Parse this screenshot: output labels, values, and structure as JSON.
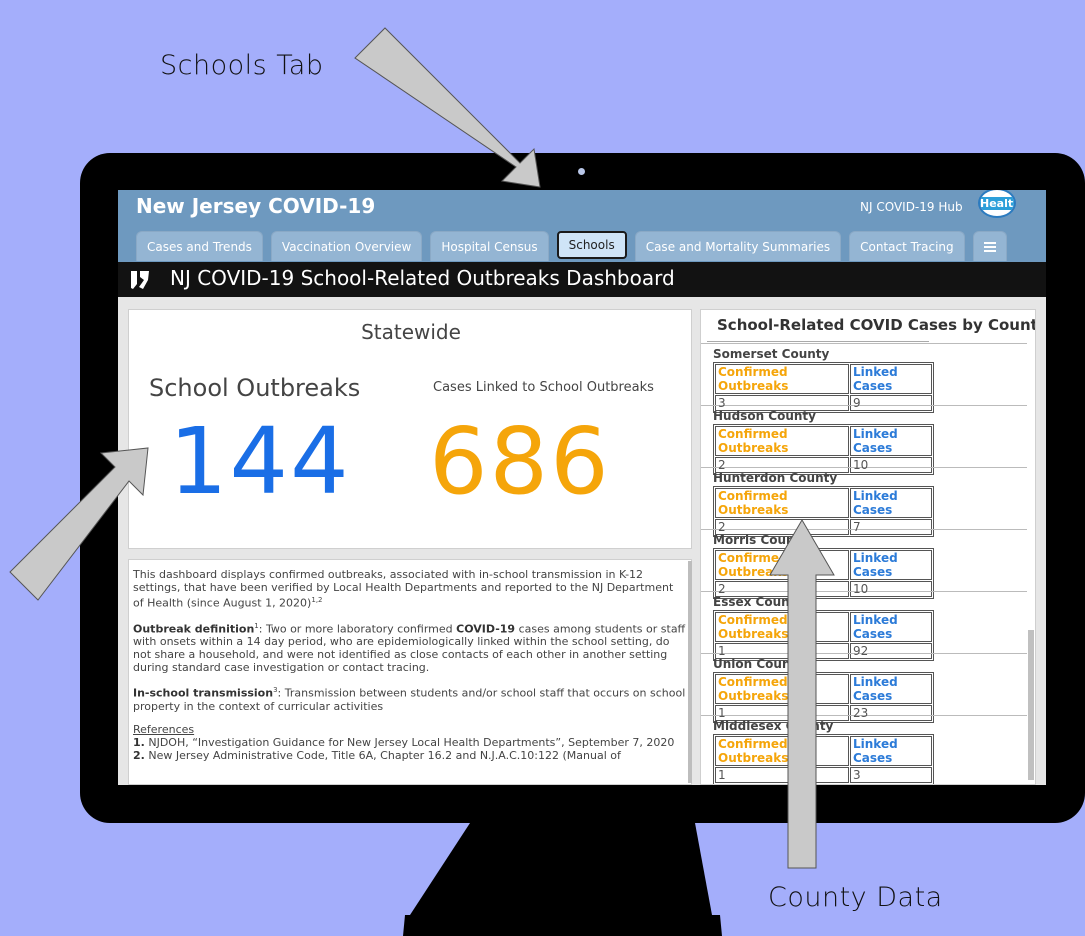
{
  "callouts": {
    "schools_tab": "Schools Tab",
    "county_data": "County Data"
  },
  "header": {
    "brand": "New Jersey COVID-19",
    "hub_link": "NJ COVID-19 Hub",
    "logo_text": "Health"
  },
  "tabs": [
    {
      "label": "Cases and Trends"
    },
    {
      "label": "Vaccination Overview"
    },
    {
      "label": "Hospital Census"
    },
    {
      "label": "Schools",
      "active": true
    },
    {
      "label": "Case and Mortality Summaries"
    },
    {
      "label": "Contact Tracing"
    }
  ],
  "dashboard": {
    "title": "NJ COVID-19 School-Related Outbreaks Dashboard"
  },
  "statewide": {
    "title": "Statewide",
    "outbreaks_label": "School Outbreaks",
    "outbreaks_value": "144",
    "cases_label": "Cases Linked to School Outbreaks",
    "cases_value": "686"
  },
  "description": {
    "intro": "This dashboard displays confirmed outbreaks, associated with in-school transmission in K-12 settings, that have been verified by Local Health Departments and reported to the NJ Department of Health (since August 1, 2020)",
    "intro_sup": "1,2",
    "outbreak_term": "Outbreak definition",
    "outbreak_sup": "1",
    "outbreak_text_a": ": Two or more laboratory confirmed ",
    "outbreak_bold": "COVID-19",
    "outbreak_text_b": " cases among students or staff with onsets within a 14 day period, who are epidemiologically linked within the school setting, do not share a household, and were not identified as close contacts of each other in another setting during standard case investigation or contact tracing.",
    "transmission_term": "In-school transmission",
    "transmission_sup": "3",
    "transmission_text": ": Transmission between students and/or school staff that occurs on school property in the context of curricular activities",
    "references_heading": "References",
    "ref1_num": "1.",
    "ref1_text": " NJDOH, “Investigation Guidance for New Jersey Local Health Departments”, September 7, 2020",
    "ref2_num": "2.",
    "ref2_text": " New Jersey Administrative Code, Title 6A, Chapter 16.2 and N.J.A.C.10:122 (Manual of"
  },
  "county_panel": {
    "title": "School-Related COVID Cases by County",
    "col_outbreaks": "Confirmed Outbreaks",
    "col_linked": "Linked Cases",
    "counties": [
      {
        "name": "Somerset County",
        "outbreaks": "3",
        "linked": "9"
      },
      {
        "name": "Hudson County",
        "outbreaks": "2",
        "linked": "10"
      },
      {
        "name": "Hunterdon County",
        "outbreaks": "2",
        "linked": "7"
      },
      {
        "name": "Morris County",
        "outbreaks": "2",
        "linked": "10"
      },
      {
        "name": "Essex County",
        "outbreaks": "1",
        "linked": "92"
      },
      {
        "name": "Union County",
        "outbreaks": "1",
        "linked": "23"
      },
      {
        "name": "Middlesex County",
        "outbreaks": "1",
        "linked": "3"
      }
    ]
  },
  "colors": {
    "background": "#a4aefb",
    "header": "#6e99bf",
    "outbreaks_blue": "#1a6ee6",
    "cases_orange": "#f5a50a"
  }
}
